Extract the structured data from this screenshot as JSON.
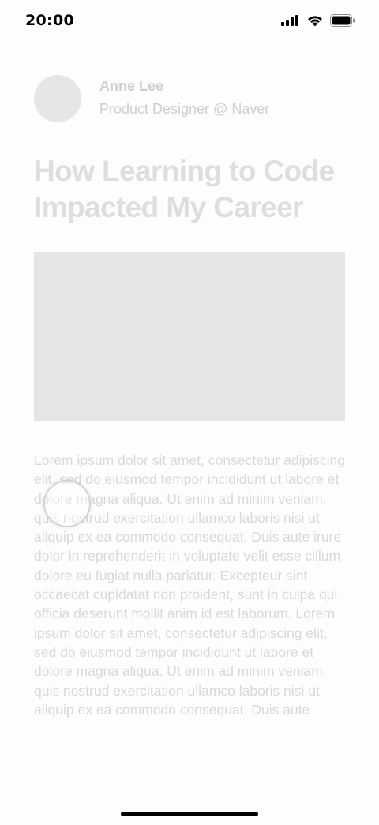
{
  "status_bar": {
    "time": "20:00",
    "icons": [
      "signal-icon",
      "wifi-icon",
      "battery-icon"
    ]
  },
  "author": {
    "name": "Anne Lee",
    "role": "Product Designer @ Naver"
  },
  "article": {
    "title": "How Learning to Code Impacted My Career",
    "body": "Lorem ipsum dolor sit amet, consectetur adipiscing elit, sed do eiusmod tempor incididunt ut labore et dolore magna aliqua. Ut enim ad minim veniam, quis nostrud exercitation ullamco laboris nisi ut aliquip ex ea commodo consequat. Duis aute irure dolor in reprehenderit in voluptate velit esse cillum dolore eu fugiat nulla pariatur. Excepteur sint occaecat cupidatat non proident, sunt in culpa qui officia deserunt mollit anim id est laborum. Lorem ipsum dolor sit amet, consectetur adipiscing elit, sed do eiusmod tempor incididunt ut labore et dolore magna aliqua. Ut enim ad minim veniam, quis nostrud exercitation ullamco laboris nisi ut aliquip ex ea commodo consequat. Duis aute"
  },
  "colors": {
    "placeholder_text": "#d9d9dc",
    "placeholder_block": "#e5e5e7",
    "status_text": "#000000"
  }
}
